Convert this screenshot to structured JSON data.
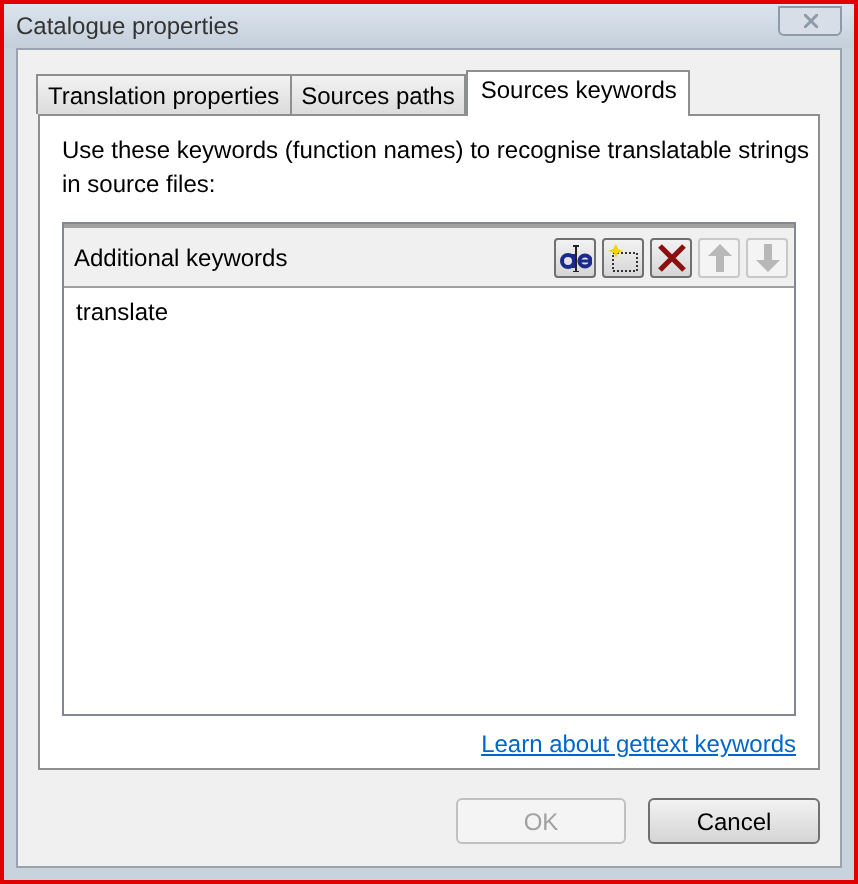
{
  "window": {
    "title": "Catalogue properties"
  },
  "tabs": [
    {
      "label": "Translation properties",
      "selected": false
    },
    {
      "label": "Sources paths",
      "selected": false
    },
    {
      "label": "Sources keywords",
      "selected": true
    }
  ],
  "description": "Use these keywords (function names) to recognise translatable strings in source files:",
  "keywords": {
    "header": "Additional keywords",
    "toolbar": [
      {
        "kind": "rename",
        "disabled": false
      },
      {
        "kind": "add",
        "disabled": false
      },
      {
        "kind": "delete",
        "disabled": false
      },
      {
        "kind": "up",
        "disabled": true
      },
      {
        "kind": "down",
        "disabled": true
      }
    ],
    "items": [
      {
        "label": "translate",
        "selected": false
      }
    ]
  },
  "link": "Learn about gettext keywords",
  "buttons": [
    {
      "label": "OK",
      "disabled": true
    },
    {
      "label": "Cancel",
      "disabled": false
    }
  ]
}
